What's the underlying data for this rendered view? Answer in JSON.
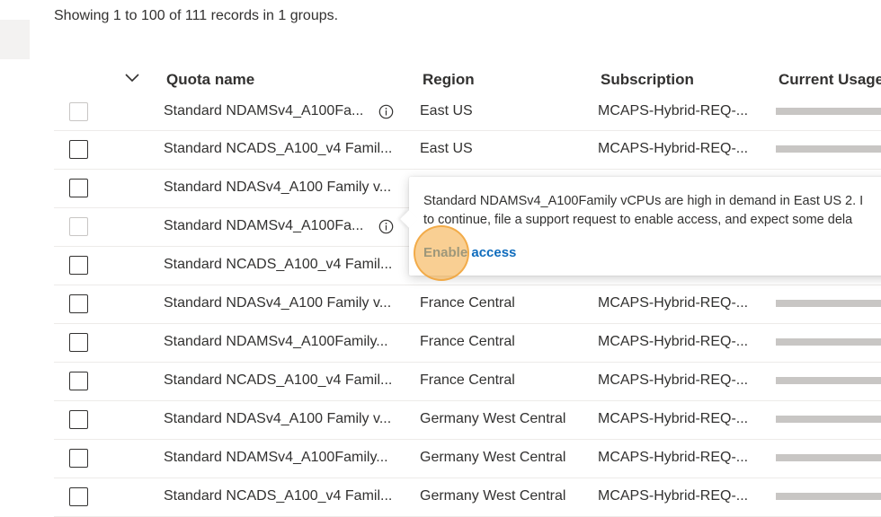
{
  "summary_text": "Showing 1 to 100 of 111 records in 1 groups.",
  "columns": {
    "quota_name": "Quota name",
    "region": "Region",
    "subscription": "Subscription",
    "current_usage": "Current Usage"
  },
  "rows": [
    {
      "name": "Standard NDAMSv4_A100Fa...",
      "region": "East US",
      "subscription": "MCAPS-Hybrid-REQ-...",
      "checkbox_enabled": false,
      "info_icon": true
    },
    {
      "name": "Standard NCADS_A100_v4 Famil...",
      "region": "East US",
      "subscription": "MCAPS-Hybrid-REQ-...",
      "checkbox_enabled": true,
      "info_icon": false
    },
    {
      "name": "Standard NDASv4_A100 Family v...",
      "region": "",
      "subscription": "",
      "checkbox_enabled": true,
      "info_icon": false
    },
    {
      "name": "Standard NDAMSv4_A100Fa...",
      "region": "",
      "subscription": "",
      "checkbox_enabled": false,
      "info_icon": true
    },
    {
      "name": "Standard NCADS_A100_v4 Famil...",
      "region": "",
      "subscription": "",
      "checkbox_enabled": true,
      "info_icon": false
    },
    {
      "name": "Standard NDASv4_A100 Family v...",
      "region": "France Central",
      "subscription": "MCAPS-Hybrid-REQ-...",
      "checkbox_enabled": true,
      "info_icon": false
    },
    {
      "name": "Standard NDAMSv4_A100Family...",
      "region": "France Central",
      "subscription": "MCAPS-Hybrid-REQ-...",
      "checkbox_enabled": true,
      "info_icon": false
    },
    {
      "name": "Standard NCADS_A100_v4 Famil...",
      "region": "France Central",
      "subscription": "MCAPS-Hybrid-REQ-...",
      "checkbox_enabled": true,
      "info_icon": false
    },
    {
      "name": "Standard NDASv4_A100 Family v...",
      "region": "Germany West Central",
      "subscription": "MCAPS-Hybrid-REQ-...",
      "checkbox_enabled": true,
      "info_icon": false
    },
    {
      "name": "Standard NDAMSv4_A100Family...",
      "region": "Germany West Central",
      "subscription": "MCAPS-Hybrid-REQ-...",
      "checkbox_enabled": true,
      "info_icon": false
    },
    {
      "name": "Standard NCADS_A100_v4 Famil...",
      "region": "Germany West Central",
      "subscription": "MCAPS-Hybrid-REQ-...",
      "checkbox_enabled": true,
      "info_icon": false
    }
  ],
  "callout": {
    "line1": "Standard NDAMSv4_A100Family vCPUs are high in demand in East US 2. I",
    "line2": "to continue, file a support request to enable access, and expect some dela",
    "link_label": "Enable access"
  },
  "colors": {
    "accent_link": "#0f6cbd",
    "usage_bar": "#c8c6c4",
    "click_highlight": "#f6b250"
  }
}
